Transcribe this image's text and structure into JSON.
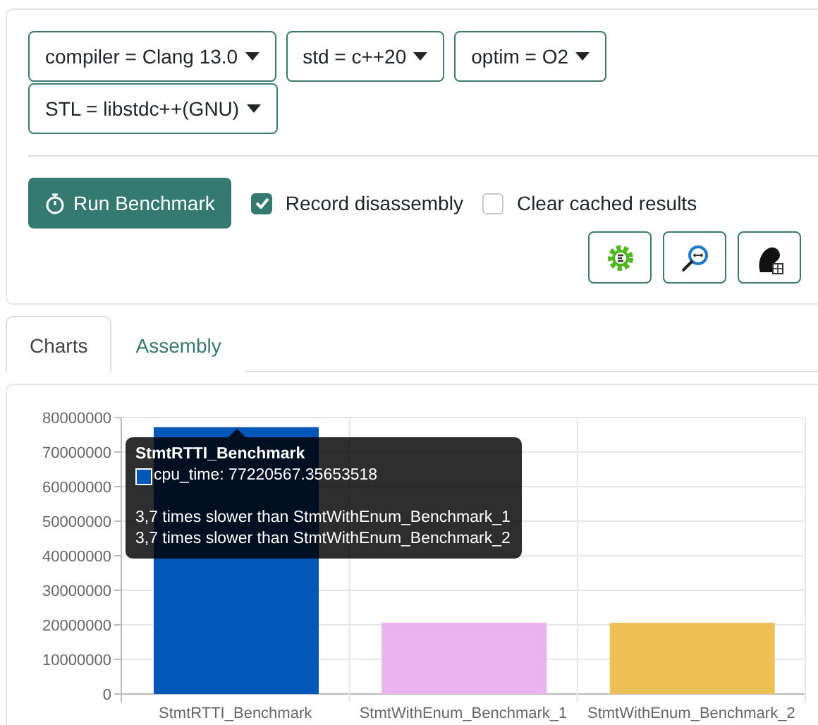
{
  "options": [
    {
      "label": "compiler = Clang 13.0"
    },
    {
      "label": "std = c++20"
    },
    {
      "label": "optim = O2"
    },
    {
      "label": "STL = libstdc++(GNU)"
    }
  ],
  "run_button": {
    "label": "Run Benchmark"
  },
  "checkboxes": [
    {
      "label": "Record disassembly",
      "checked": true
    },
    {
      "label": "Clear cached results",
      "checked": false
    }
  ],
  "tabs": [
    {
      "label": "Charts",
      "selected": true
    },
    {
      "label": "Assembly",
      "selected": false
    }
  ],
  "chart": {
    "chart_data": {
      "type": "bar",
      "categories": [
        "StmtRTTI_Benchmark",
        "StmtWithEnum_Benchmark_1",
        "StmtWithEnum_Benchmark_2"
      ],
      "values": [
        77200000,
        20600000,
        20600000
      ],
      "ylim": [
        0,
        80000000
      ],
      "grid": true,
      "yticks": [
        0,
        10000000,
        20000000,
        30000000,
        40000000,
        50000000,
        60000000,
        70000000,
        80000000
      ]
    },
    "bars": [
      {
        "color": "#0057b8"
      },
      {
        "color": "#e9b3f0"
      },
      {
        "color": "#ecc055"
      }
    ],
    "tooltip": {
      "title": "StmtRTTI_Benchmark",
      "series_line": "cpu_time: 77220567.35653518",
      "color": "#0057b8",
      "notes": [
        "3,7 times slower than StmtWithEnum_Benchmark_1",
        "3,7 times slower than StmtWithEnum_Benchmark_2"
      ]
    }
  }
}
